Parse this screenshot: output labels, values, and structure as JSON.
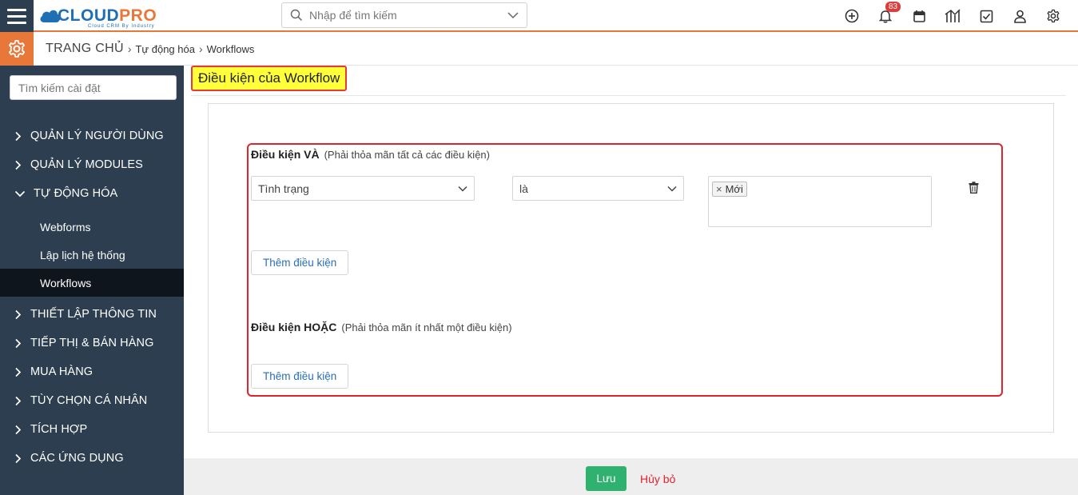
{
  "header": {
    "logo_brand_a": "CLOUD",
    "logo_brand_b": "PRO",
    "logo_sub": "Cloud CRM By Industry",
    "search_placeholder": "Nhập để tìm kiếm",
    "notification_count": "83",
    "icons": [
      "plus-circle-icon",
      "bell-icon",
      "calendar-icon",
      "chart-icon",
      "checkbox-icon",
      "user-icon",
      "gear-icon"
    ]
  },
  "breadcrumb": {
    "home": "TRANG CHỦ",
    "level1": "Tự động hóa",
    "level2": "Workflows"
  },
  "sidebar": {
    "search_placeholder": "Tìm kiếm cài đặt",
    "items": [
      {
        "label": "QUẢN LÝ NGƯỜI DÙNG",
        "expanded": false
      },
      {
        "label": "QUẢN LÝ MODULES",
        "expanded": false
      },
      {
        "label": "TỰ ĐỘNG HÓA",
        "expanded": true
      },
      {
        "label": "THIẾT LẬP THÔNG TIN",
        "expanded": false
      },
      {
        "label": "TIẾP THỊ & BÁN HÀNG",
        "expanded": false
      },
      {
        "label": "MUA HÀNG",
        "expanded": false
      },
      {
        "label": "TÙY CHỌN CÁ NHÂN",
        "expanded": false
      },
      {
        "label": "TÍCH HỢP",
        "expanded": false
      },
      {
        "label": "CÁC ỨNG DỤNG",
        "expanded": false
      }
    ],
    "subitems": [
      {
        "label": "Webforms",
        "active": false
      },
      {
        "label": "Lập lịch hệ thống",
        "active": false
      },
      {
        "label": "Workflows",
        "active": true
      }
    ]
  },
  "main": {
    "page_title": "Điều kiện của Workflow",
    "and_group": {
      "title": "Điều kiện VÀ",
      "hint": "(Phải thỏa mãn tất cả các điều kiện)",
      "field": "Tình trạng",
      "operator": "là",
      "values": [
        "Mới"
      ],
      "add_label": "Thêm điều kiện"
    },
    "or_group": {
      "title": "Điều kiện HOẶC",
      "hint": "(Phải thỏa mãn ít nhất một điều kiện)",
      "add_label": "Thêm điều kiện"
    }
  },
  "footer": {
    "save_label": "Lưu",
    "cancel_label": "Hủy bỏ"
  },
  "colors": {
    "sidebar_bg": "#2c3e50",
    "accent_orange": "#e8773a",
    "save_green": "#2fb170",
    "highlight_red": "#e0242e",
    "title_yellow": "#ffff3a"
  }
}
